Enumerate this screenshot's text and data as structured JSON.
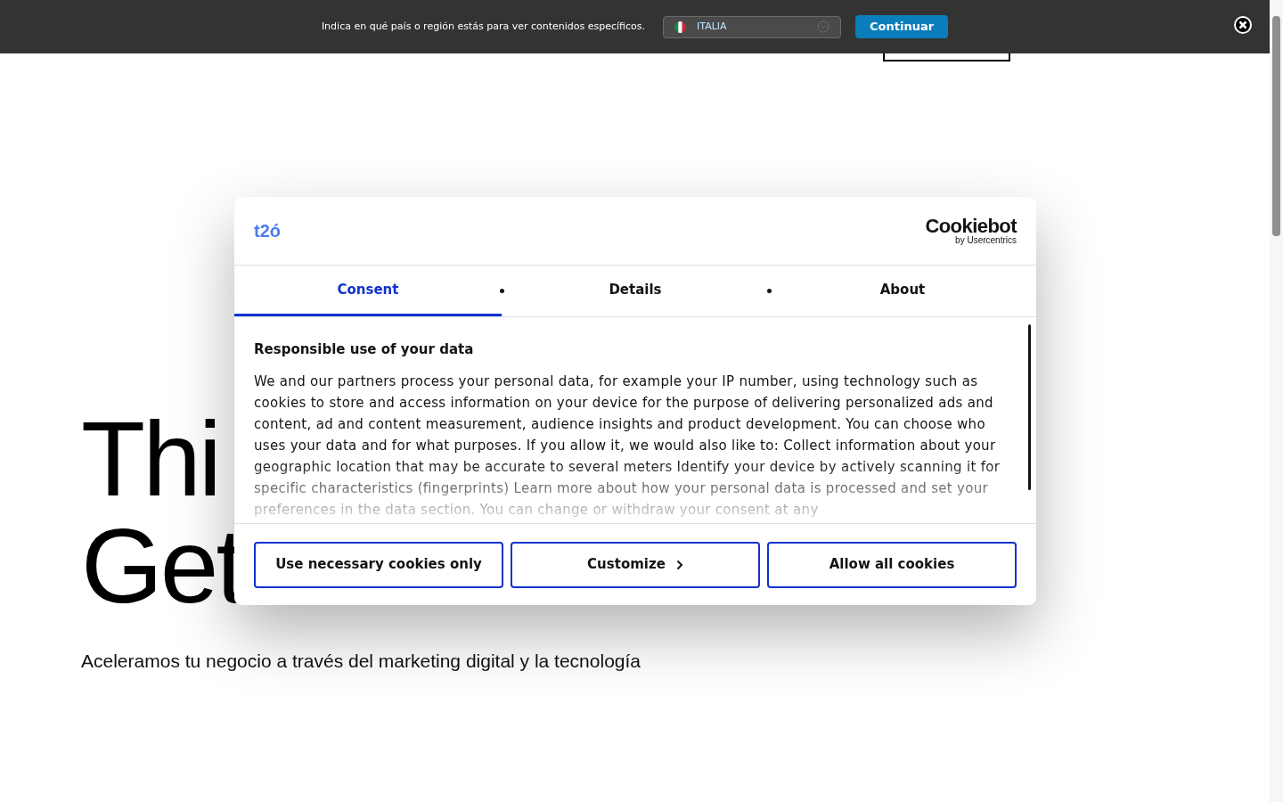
{
  "region_banner": {
    "prompt": "Indica en qué país o región estás para ver contenidos específicos.",
    "country": "ITALIA",
    "button": "Continuar"
  },
  "hero": {
    "heading_lines": [
      "Thi",
      "Get"
    ],
    "subtitle": "Aceleramos tu negocio a través del marketing digital y la tecnología"
  },
  "cookie_dialog": {
    "logo": "t2ó",
    "brand": "Cookiebot",
    "brand_sub": "by Usercentrics",
    "tabs": [
      {
        "label": "Consent",
        "selected": true
      },
      {
        "label": "Details",
        "selected": false
      },
      {
        "label": "About",
        "selected": false
      }
    ],
    "heading": "Responsible use of your data",
    "body": "We and our partners process your personal data, for example your IP number, using technology such as cookies to store and access information on your device for the purpose of delivering personalized ads and content, ad and content measurement, audience insights and product development. You can choose who uses your data and for what purposes. If you allow it, we would also like to: Collect information about your geographic location that may be accurate to several meters Identify your device by actively scanning it for specific characteristics (fingerprints) Learn more about how your personal data is processed and set your preferences in the data section. You can change or withdraw your consent at any",
    "buttons": [
      {
        "label": "Use necessary cookies only",
        "kind": "plain"
      },
      {
        "label": "Customize",
        "kind": "chevron"
      },
      {
        "label": "Allow all cookies",
        "kind": "plain"
      }
    ]
  }
}
